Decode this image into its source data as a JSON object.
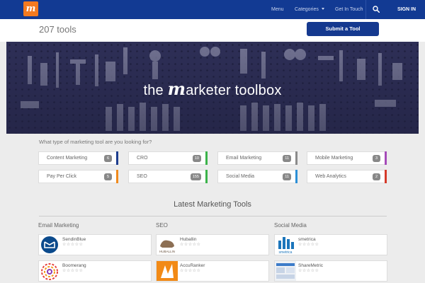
{
  "nav": {
    "logo": "m",
    "menu": "Menu",
    "categories": "Categories",
    "get_in_touch": "Get In Touch",
    "sign_in": "SIGN IN"
  },
  "header": {
    "tools_count": "207 tools",
    "submit_label": "Submit a Tool"
  },
  "hero": {
    "title_before": "the ",
    "title_m": "m",
    "title_after": "arketer toolbox"
  },
  "question": "What type of marketing tool are you looking for?",
  "categories": [
    {
      "label": "Content Marketing",
      "count": "6",
      "color": "#1d3d8f"
    },
    {
      "label": "CRO",
      "count": "10",
      "color": "#3bb34a"
    },
    {
      "label": "Email Marketing",
      "count": "11",
      "color": "#8a8a8a"
    },
    {
      "label": "Mobile Marketing",
      "count": "3",
      "color": "#a54bb8"
    },
    {
      "label": "Pay Per Click",
      "count": "5",
      "color": "#f08a1d"
    },
    {
      "label": "SEO",
      "count": "155",
      "color": "#3bb34a"
    },
    {
      "label": "Social Media",
      "count": "11",
      "color": "#2c8fd6"
    },
    {
      "label": "Web Analytics",
      "count": "2",
      "color": "#d53a2a"
    }
  ],
  "latest": {
    "title": "Latest Marketing Tools",
    "columns": [
      {
        "title": "Email Marketing",
        "tools": [
          {
            "name": "SendinBlue",
            "rating": "☆☆☆☆☆"
          },
          {
            "name": "Boomerang",
            "rating": "☆☆☆☆☆"
          }
        ]
      },
      {
        "title": "SEO",
        "tools": [
          {
            "name": "Huballin",
            "rating": "☆☆☆☆☆",
            "thumb_text": "HUBALLIN"
          },
          {
            "name": "AccuRanker",
            "rating": "☆☆☆☆☆"
          }
        ]
      },
      {
        "title": "Social Media",
        "tools": [
          {
            "name": "smetrica",
            "rating": "☆☆☆☆☆",
            "thumb_text": "smetrica"
          },
          {
            "name": "ShareMetric",
            "rating": "☆☆☆☆☆"
          }
        ]
      }
    ]
  }
}
